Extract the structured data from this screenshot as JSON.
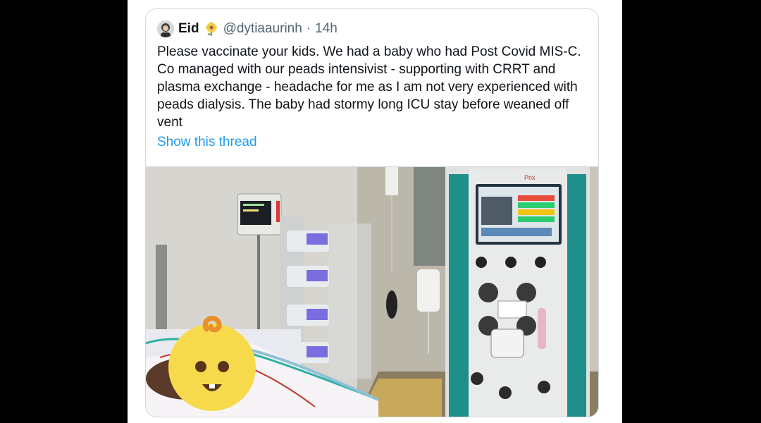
{
  "tweet": {
    "author": {
      "display_name": "Eid",
      "handle": "@dytiaaurinh",
      "separator": "·",
      "time": "14h"
    },
    "text_lines": [
      "Please vaccinate your kids. We had a baby who had Post Covid MIS-C.",
      "Co managed with our peads intensivist - supporting with CRRT and",
      "plasma exchange - headache for me as I am not very experienced with",
      "peads dialysis. The baby had stormy long ICU stay before weaned off",
      "vent"
    ],
    "show_thread_label": "Show this thread",
    "media": {
      "machine_brand": "Prix",
      "overlay_icon": "baby-emoji-icon"
    }
  },
  "colors": {
    "link": "#1d9bf0",
    "text": "#0f1419",
    "secondary": "#536471",
    "border": "#cfd9de",
    "machine_teal": "#1f8f8c",
    "emoji_yellow": "#f7d94c"
  }
}
